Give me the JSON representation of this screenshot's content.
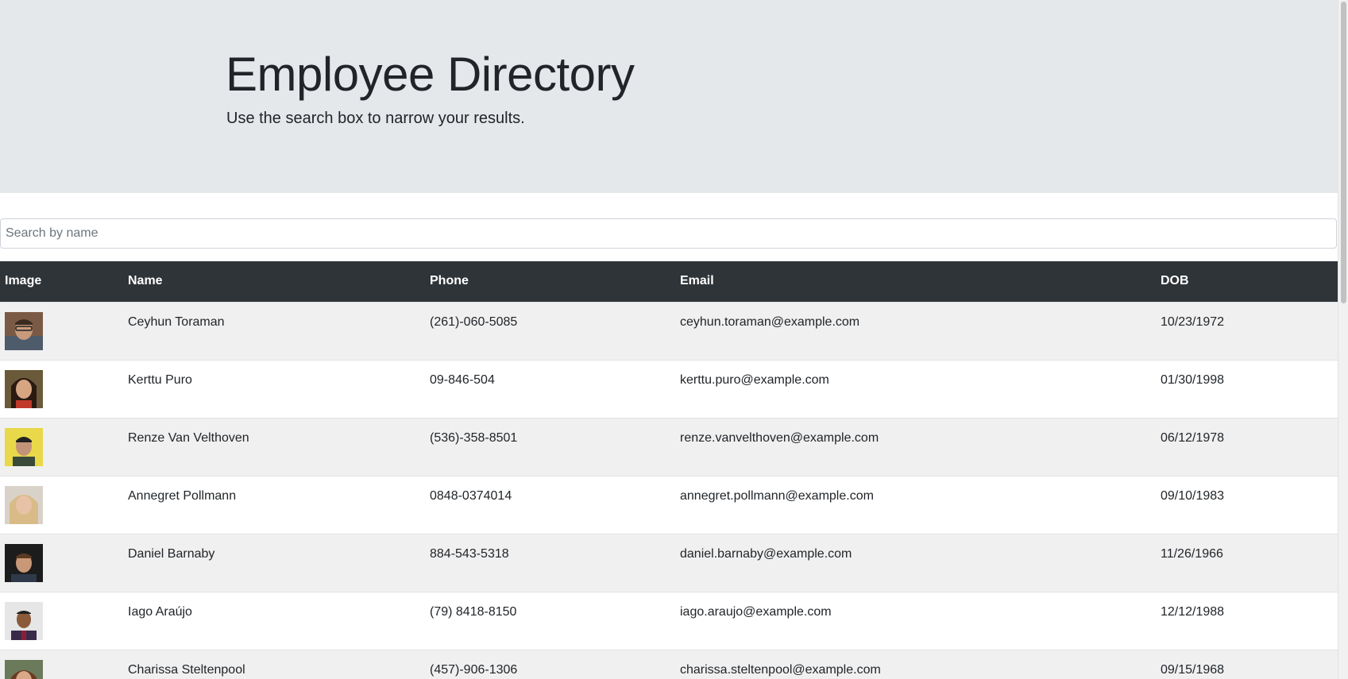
{
  "header": {
    "title": "Employee Directory",
    "subtitle": "Use the search box to narrow your results."
  },
  "search": {
    "placeholder": "Search by name",
    "value": ""
  },
  "table": {
    "columns": [
      "Image",
      "Name",
      "Phone",
      "Email",
      "DOB"
    ],
    "rows": [
      {
        "image": "avatar-photo",
        "name": "Ceyhun Toraman",
        "phone": "(261)-060-5085",
        "email": "ceyhun.toraman@example.com",
        "dob": "10/23/1972"
      },
      {
        "image": "avatar-photo",
        "name": "Kerttu Puro",
        "phone": "09-846-504",
        "email": "kerttu.puro@example.com",
        "dob": "01/30/1998"
      },
      {
        "image": "avatar-photo",
        "name": "Renze Van Velthoven",
        "phone": "(536)-358-8501",
        "email": "renze.vanvelthoven@example.com",
        "dob": "06/12/1978"
      },
      {
        "image": "avatar-photo",
        "name": "Annegret Pollmann",
        "phone": "0848-0374014",
        "email": "annegret.pollmann@example.com",
        "dob": "09/10/1983"
      },
      {
        "image": "avatar-photo",
        "name": "Daniel Barnaby",
        "phone": "884-543-5318",
        "email": "daniel.barnaby@example.com",
        "dob": "11/26/1966"
      },
      {
        "image": "avatar-photo",
        "name": "Iago Araújo",
        "phone": "(79) 8418-8150",
        "email": "iago.araujo@example.com",
        "dob": "12/12/1988"
      },
      {
        "image": "avatar-photo",
        "name": "Charissa Steltenpool",
        "phone": "(457)-906-1306",
        "email": "charissa.steltenpool@example.com",
        "dob": "09/15/1968"
      }
    ]
  },
  "colors": {
    "jumbotron_bg": "#e4e8eb",
    "table_header_bg": "#2f3438",
    "row_striped_bg": "#f0f0f0"
  }
}
